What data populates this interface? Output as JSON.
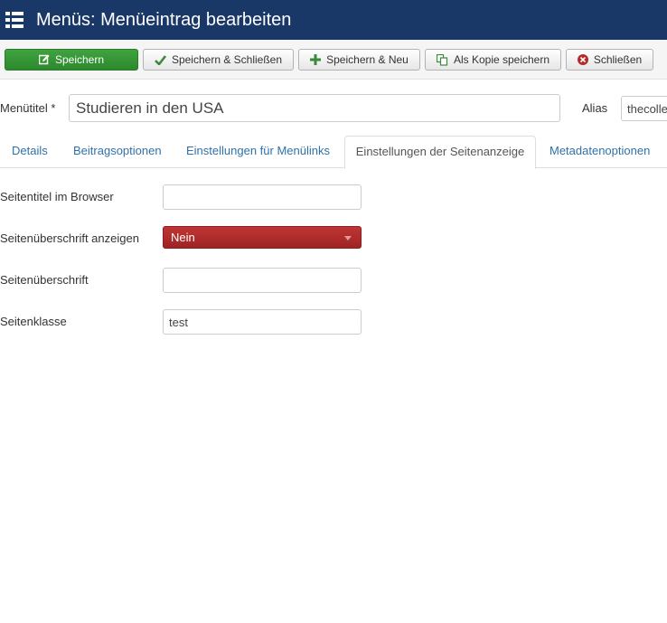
{
  "header": {
    "title": "Menüs: Menüeintrag bearbeiten",
    "icon": "list-icon",
    "background_color": "#1a3867"
  },
  "toolbar": {
    "save_label": "Speichern",
    "save_close_label": "Speichern & Schließen",
    "save_new_label": "Speichern & Neu",
    "save_copy_label": "Als Kopie speichern",
    "close_label": "Schließen",
    "save_color": "#2d882d"
  },
  "form": {
    "title_label": "Menütitel *",
    "title_value": "Studieren in den USA",
    "alias_label": "Alias",
    "alias_value": "thecolle"
  },
  "tabs": [
    {
      "label": "Details",
      "active": false
    },
    {
      "label": "Beitragsoptionen",
      "active": false
    },
    {
      "label": "Einstellungen für Menülinks",
      "active": false
    },
    {
      "label": "Einstellungen der Seitenanzeige",
      "active": true
    },
    {
      "label": "Metadatenoptionen",
      "active": false
    }
  ],
  "fields": {
    "browser_title_label": "Seitentitel im Browser",
    "browser_title_value": "",
    "show_heading_label": "Seitenüberschrift anzeigen",
    "show_heading_value": "Nein",
    "show_heading_color": "#9e2424",
    "heading_label": "Seitenüberschrift",
    "heading_value": "",
    "page_class_label": "Seitenklasse",
    "page_class_value": "test"
  }
}
